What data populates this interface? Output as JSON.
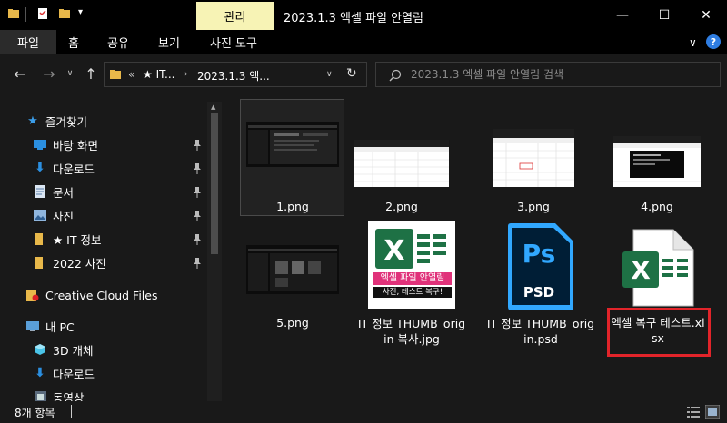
{
  "window": {
    "title": "2023.1.3 엑셀 파일 안열림",
    "manage_tab": "관리",
    "minimize": "—",
    "maximize": "☐",
    "close": "✕"
  },
  "ribbon": {
    "tabs": [
      "파일",
      "홈",
      "공유",
      "보기",
      "사진 도구"
    ],
    "collapse": "∨",
    "help": "?"
  },
  "address": {
    "overflow": "«",
    "crumbs": [
      "★ IT...",
      "2023.1.3 엑..."
    ],
    "search_placeholder": "2023.1.3 엑셀 파일 안열림 검색"
  },
  "sidebar": {
    "quick_access": "즐겨찾기",
    "items": [
      {
        "label": "바탕 화면",
        "icon": "desktop-icon",
        "pinned": true
      },
      {
        "label": "다운로드",
        "icon": "download-icon",
        "pinned": true
      },
      {
        "label": "문서",
        "icon": "document-icon",
        "pinned": true
      },
      {
        "label": "사진",
        "icon": "pictures-icon",
        "pinned": true
      },
      {
        "label": "★ IT 정보",
        "icon": "folder-icon",
        "pinned": true
      },
      {
        "label": "2022 사진",
        "icon": "folder-icon",
        "pinned": true
      }
    ],
    "creative_cloud": "Creative Cloud Files",
    "this_pc": "내 PC",
    "pc_items": [
      {
        "label": "3D 개체",
        "icon": "3d-objects-icon"
      },
      {
        "label": "다운로드",
        "icon": "download-icon"
      },
      {
        "label": "동영상",
        "icon": "video-icon"
      }
    ]
  },
  "files": [
    {
      "name": "1.png",
      "type": "screenshot"
    },
    {
      "name": "2.png",
      "type": "sheet"
    },
    {
      "name": "3.png",
      "type": "sheet"
    },
    {
      "name": "4.png",
      "type": "dark-sheet"
    },
    {
      "name": "5.png",
      "type": "screenshot"
    },
    {
      "name": "IT 정보 THUMB_origin 복사.jpg",
      "type": "excel-thumb",
      "thumb_title": "엑셀 파일 안열림",
      "thumb_sub": "사진, 테스트 복구!"
    },
    {
      "name": "IT 정보 THUMB_origin.psd",
      "type": "psd",
      "psd_label": "PSD",
      "psd_logo": "Ps"
    },
    {
      "name": "엑셀 복구 테스트.xlsx",
      "type": "xlsx",
      "highlighted": true
    }
  ],
  "status": {
    "count": "8개 항목"
  },
  "colors": {
    "manage_tab": "#f7f3b5",
    "highlight": "#e2242a",
    "excel_green": "#1e7145",
    "ps_blue": "#31a8ff",
    "ps_bg": "#001e36"
  }
}
